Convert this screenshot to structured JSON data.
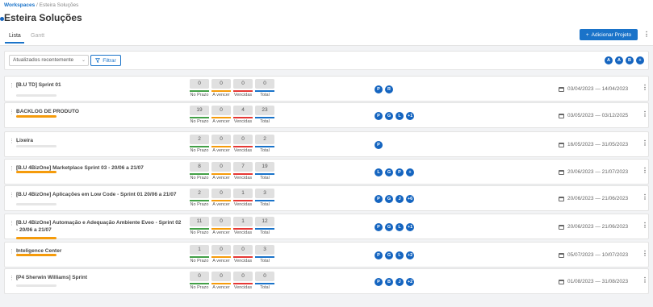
{
  "breadcrumb": {
    "root": "Workspaces",
    "sep": "/",
    "current": "Esteira Soluções"
  },
  "page_title": "Esteira Soluções",
  "tabs": [
    {
      "label": "Lista",
      "active": true
    },
    {
      "label": "Gantt",
      "active": false
    }
  ],
  "add_button": {
    "icon": "+",
    "label": "Adicionar Projeto"
  },
  "kebab": "⋮",
  "filters": {
    "sort_value": "Atualizados recentemente",
    "filter_label": "Filtrar"
  },
  "top_avatars": [
    "A",
    "A",
    "B",
    "+"
  ],
  "stat_labels": [
    "No Prazo",
    "A vencer",
    "Vencidas",
    "Total"
  ],
  "colors": {
    "accent": "#1a73c9",
    "avatar": "#1565c0",
    "no_prazo": "#43a047",
    "a_vencer": "#f59b0b",
    "vencidas": "#e53935",
    "total": "#1a73c9",
    "progress": "#f59b0b"
  },
  "rows": [
    {
      "name": "[B.U TD] Sprint 01",
      "progress_bar": "gray",
      "stats": [
        "0",
        "0",
        "0",
        "0"
      ],
      "team": [
        "P",
        "R"
      ],
      "date": "03/04/2023 — 14/04/2023"
    },
    {
      "name": "BACKLOG DE PRODUTO",
      "progress_bar": "orange",
      "stats": [
        "19",
        "0",
        "4",
        "23"
      ],
      "team": [
        "P",
        "G",
        "L",
        "+1"
      ],
      "date": "03/05/2023 — 03/12/2025"
    },
    {
      "name": "Lixeira",
      "progress_bar": "gray",
      "stats": [
        "2",
        "0",
        "0",
        "2"
      ],
      "team": [
        "P"
      ],
      "date": "16/05/2023 — 31/05/2023"
    },
    {
      "name": "[B.U 4BizOne] Marketplace Sprint 03 - 20/06 a 21/07",
      "progress_bar": "orange",
      "stats": [
        "8",
        "0",
        "7",
        "19"
      ],
      "team": [
        "L",
        "G",
        "P",
        "+"
      ],
      "date": "20/06/2023 — 21/07/2023"
    },
    {
      "name": "[B.U 4BizOne] Aplicações em Low Code - Sprint 01 20/06 a 21/07",
      "progress_bar": "gray",
      "stats": [
        "2",
        "0",
        "1",
        "3"
      ],
      "team": [
        "P",
        "G",
        "J",
        "+6"
      ],
      "date": "20/06/2023 — 21/06/2023"
    },
    {
      "name": "[B.U 4BizOne] Automação e Adequação Ambiente Eveo - Sprint 02 - 20/06 a 21/07",
      "progress_bar": "orange",
      "stats": [
        "11",
        "0",
        "1",
        "12"
      ],
      "team": [
        "P",
        "G",
        "L",
        "+1"
      ],
      "date": "20/06/2023 — 21/06/2023"
    },
    {
      "name": "Inteligence Center",
      "progress_bar": "orange",
      "stats": [
        "1",
        "0",
        "0",
        "3"
      ],
      "team": [
        "P",
        "G",
        "L",
        "+2"
      ],
      "date": "05/07/2023 — 10/07/2023"
    },
    {
      "name": "[P4 Sherwin Williams] Sprint",
      "progress_bar": "gray",
      "stats": [
        "0",
        "0",
        "0",
        "0"
      ],
      "team": [
        "P",
        "B",
        "J",
        "+2"
      ],
      "date": "01/08/2023 — 31/08/2023"
    }
  ]
}
